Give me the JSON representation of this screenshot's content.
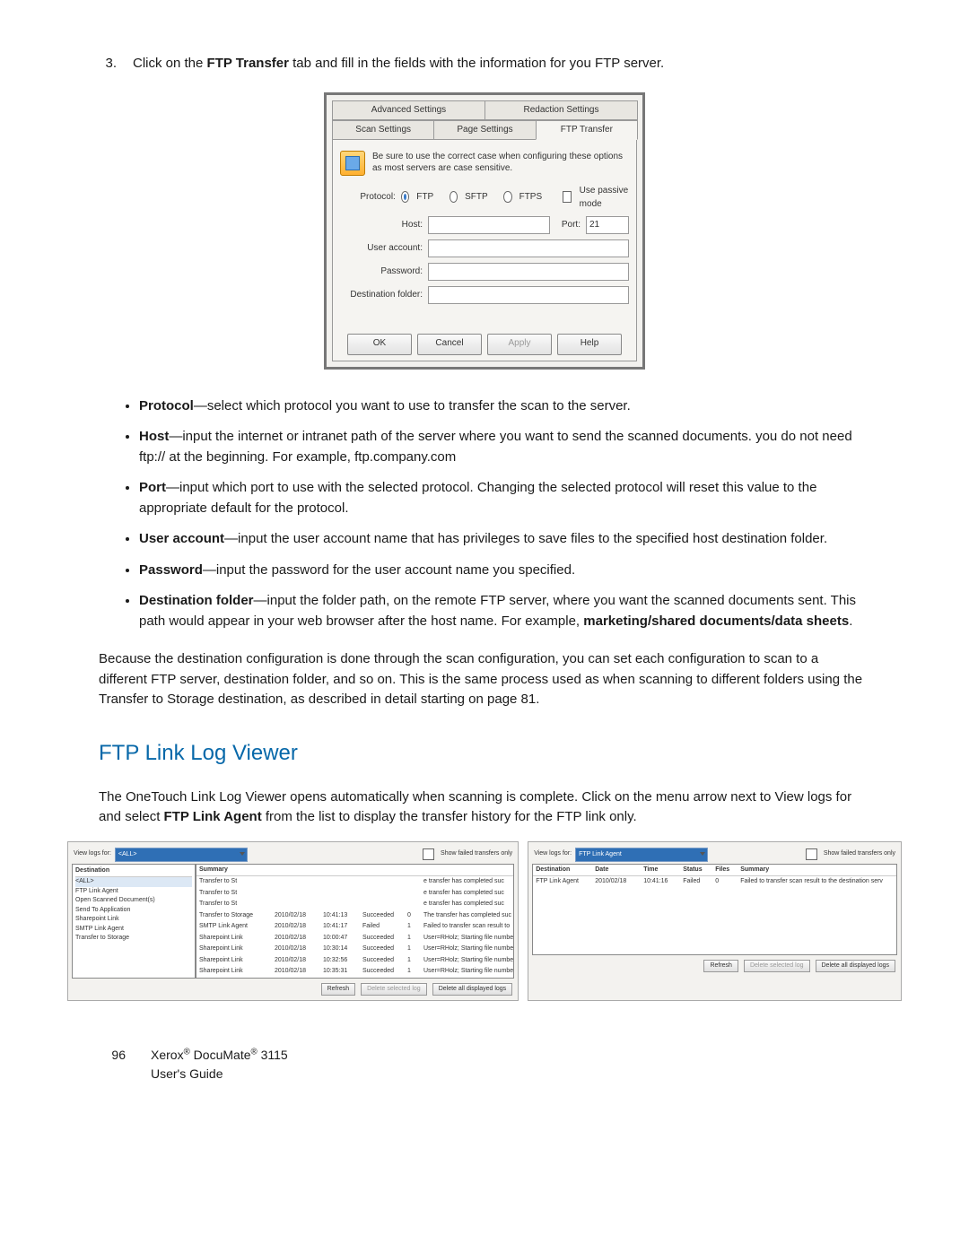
{
  "step": {
    "num": "3.",
    "before": "Click on the ",
    "bold": "FTP Transfer",
    "after": " tab and fill in the fields with the information for you FTP server."
  },
  "dlg": {
    "tabs": {
      "adv": "Advanced Settings",
      "red": "Redaction Settings",
      "scan": "Scan Settings",
      "page": "Page Settings",
      "ftp": "FTP Transfer"
    },
    "note": "Be sure to use the correct case when configuring these options as most servers are case sensitive.",
    "protocol_label": "Protocol:",
    "proto": {
      "ftp": "FTP",
      "sftp": "SFTP",
      "ftps": "FTPS"
    },
    "passive": "Use passive mode",
    "host": "Host:",
    "port_label": "Port:",
    "port_value": "21",
    "user": "User account:",
    "pass": "Password:",
    "dest": "Destination folder:",
    "buttons": {
      "ok": "OK",
      "cancel": "Cancel",
      "apply": "Apply",
      "help": "Help"
    }
  },
  "bullets": {
    "protocol": {
      "k": "Protocol",
      "v": "—select which protocol you want to use to transfer the scan to the server."
    },
    "host": {
      "k": "Host",
      "v": "—input the internet or intranet path of the server where you want to send the scanned documents. you do not need ftp:// at the beginning. For example, ftp.company.com"
    },
    "port": {
      "k": "Port",
      "v": "—input which port to use with the selected protocol. Changing the selected protocol will reset this value to the appropriate default for the protocol."
    },
    "user": {
      "k": "User account",
      "v": "—input the user account name that has privileges to save files to the specified host destination folder."
    },
    "pass": {
      "k": "Password",
      "v": "—input the password for the user account name you specified."
    },
    "dest": {
      "k": "Destination folder",
      "v1": "—input the folder path, on the remote FTP server, where you want the scanned documents sent. This path would appear in your web browser after the host name. For example, ",
      "v2": "marketing/shared documents/data sheets",
      "v3": "."
    }
  },
  "para1": "Because the destination configuration is done through the scan configuration, you can set each configuration to scan to a different FTP server, destination folder, and so on. This is the same process used as when scanning to different folders using the Transfer to Storage destination, as described in detail starting on page 81.",
  "h2": "FTP Link Log Viewer",
  "para2a": "The OneTouch Link Log Viewer opens automatically when scanning is complete. Click on the menu arrow next to View logs for and select ",
  "para2b": "FTP Link Agent",
  "para2c": " from the list to display the transfer history for the FTP link only.",
  "log": {
    "viewfor": "View logs for:",
    "all": "<ALL>",
    "showfailed": "Show failed transfers only",
    "dd_items": [
      "<ALL>",
      "FTP Link Agent",
      "Open Scanned Document(s)",
      "Send To Application",
      "Sharepoint Link",
      "SMTP Link Agent",
      "Transfer to Storage"
    ],
    "ftpagent": "FTP Link Agent",
    "cols": {
      "dest": "Destination",
      "date": "Date",
      "time": "Time",
      "status": "Status",
      "files": "Files",
      "summary": "Summary"
    },
    "rows_left": [
      {
        "d": "Transfer to St",
        "dt": "",
        "t": "",
        "s": "",
        "f": "",
        "m": "e transfer has completed suc"
      },
      {
        "d": "Transfer to St",
        "dt": "",
        "t": "",
        "s": "",
        "f": "",
        "m": "e transfer has completed suc"
      },
      {
        "d": "Transfer to St",
        "dt": "",
        "t": "",
        "s": "",
        "f": "",
        "m": "e transfer has completed suc"
      },
      {
        "d": "Transfer to Storage",
        "dt": "2010/02/18",
        "t": "10:41:13",
        "s": "Succeeded",
        "f": "0",
        "m": "The transfer has completed suc"
      },
      {
        "d": "SMTP Link Agent",
        "dt": "2010/02/18",
        "t": "10:41:17",
        "s": "Failed",
        "f": "1",
        "m": "Failed to transfer scan result to"
      },
      {
        "d": "Sharepoint Link",
        "dt": "2010/02/18",
        "t": "10:00:47",
        "s": "Succeeded",
        "f": "1",
        "m": "User=RHolz; Starting file numbe"
      },
      {
        "d": "Sharepoint Link",
        "dt": "2010/02/18",
        "t": "10:30:14",
        "s": "Succeeded",
        "f": "1",
        "m": "User=RHolz; Starting file numbe"
      },
      {
        "d": "Sharepoint Link",
        "dt": "2010/02/18",
        "t": "10:32:56",
        "s": "Succeeded",
        "f": "1",
        "m": "User=RHolz; Starting file numbe"
      },
      {
        "d": "Sharepoint Link",
        "dt": "2010/02/18",
        "t": "10:35:31",
        "s": "Succeeded",
        "f": "1",
        "m": "User=RHolz; Starting file numbe"
      }
    ],
    "row_right": {
      "d": "FTP Link Agent",
      "dt": "2010/02/18",
      "t": "10:41:16",
      "s": "Failed",
      "f": "0",
      "m": "Failed to transfer scan result to the destination serv"
    },
    "btns": {
      "refresh": "Refresh",
      "delsel": "Delete selected log",
      "delall": "Delete all displayed logs"
    }
  },
  "footer": {
    "page": "96",
    "line1a": "Xerox",
    "line1b": " DocuMate",
    "line1c": " 3115",
    "line2": "User's Guide",
    "reg": "®"
  }
}
